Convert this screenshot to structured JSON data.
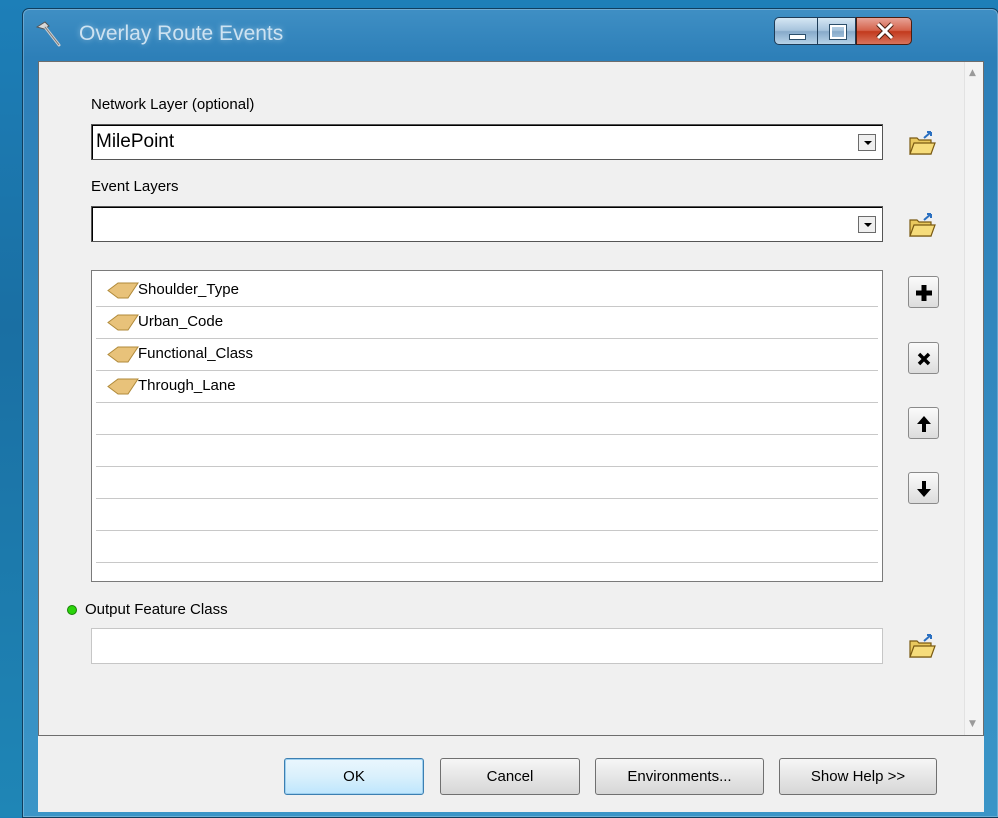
{
  "window": {
    "title": "Overlay Route Events",
    "controls": {
      "minimize": "minimize",
      "maximize": "maximize",
      "close": "close"
    }
  },
  "form": {
    "network_layer": {
      "label": "Network Layer (optional)",
      "value": "MilePoint"
    },
    "event_layers": {
      "label": "Event Layers",
      "value": "",
      "items": [
        {
          "label": "Shoulder_Type"
        },
        {
          "label": "Urban_Code"
        },
        {
          "label": "Functional_Class"
        },
        {
          "label": "Through_Lane"
        }
      ],
      "empty_rows": 5
    },
    "output_feature_class": {
      "label": "Output Feature Class",
      "value": ""
    }
  },
  "buttons": {
    "ok": "OK",
    "cancel": "Cancel",
    "environments": "Environments...",
    "show_help": "Show Help >>"
  },
  "colors": {
    "required_indicator": "#2bd40b",
    "layer_icon": "#e8c27a",
    "close_button": "#c9442f"
  }
}
